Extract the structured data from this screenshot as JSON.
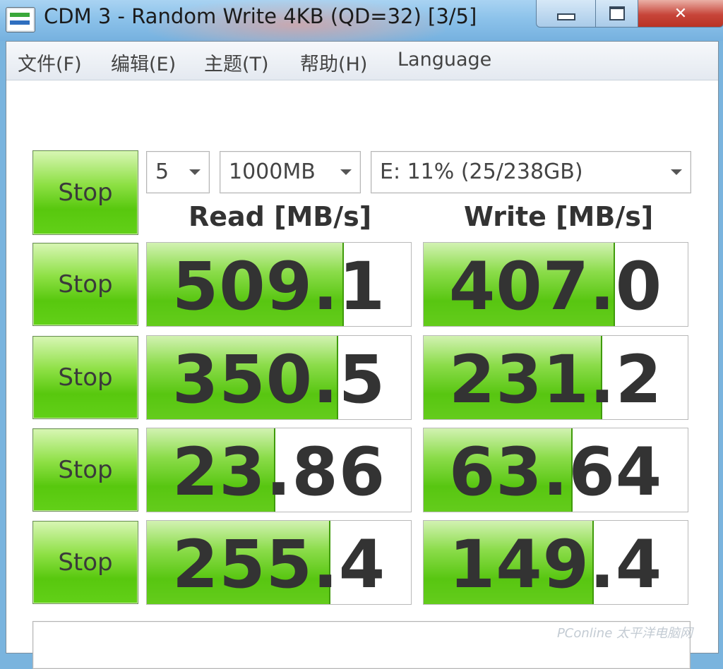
{
  "window": {
    "title": "CDM 3 - Random Write 4KB (QD=32) [3/5]",
    "icon": "cdm-app-icon",
    "controls": {
      "minimize": "minimize-icon",
      "maximize": "maximize-icon",
      "close": "✕"
    }
  },
  "menu": [
    {
      "label": "文件(F)"
    },
    {
      "label": "编辑(E)"
    },
    {
      "label": "主题(T)"
    },
    {
      "label": "帮助(H)"
    },
    {
      "label": "Language"
    }
  ],
  "controls": {
    "all_button": "Stop",
    "count": "5",
    "size": "1000MB",
    "drive": "E: 11% (25/238GB)"
  },
  "headers": {
    "read": "Read [MB/s]",
    "write": "Write [MB/s]"
  },
  "colors": {
    "bar_green": "#58c611",
    "title_bar": "#8cc2ea",
    "close_red": "#c7453a"
  },
  "rows": [
    {
      "button": "Stop",
      "read": "509.1",
      "read_fill": 0.74,
      "write": "407.0",
      "write_fill": 0.72
    },
    {
      "button": "Stop",
      "read": "350.5",
      "read_fill": 0.72,
      "write": "231.2",
      "write_fill": 0.67
    },
    {
      "button": "Stop",
      "read": "23.86",
      "read_fill": 0.48,
      "write": "63.64",
      "write_fill": 0.56
    },
    {
      "button": "Stop",
      "read": "255.4",
      "read_fill": 0.69,
      "write": "149.4",
      "write_fill": 0.64
    }
  ],
  "comment": "",
  "watermark": "PConline 太平洋电脑网"
}
